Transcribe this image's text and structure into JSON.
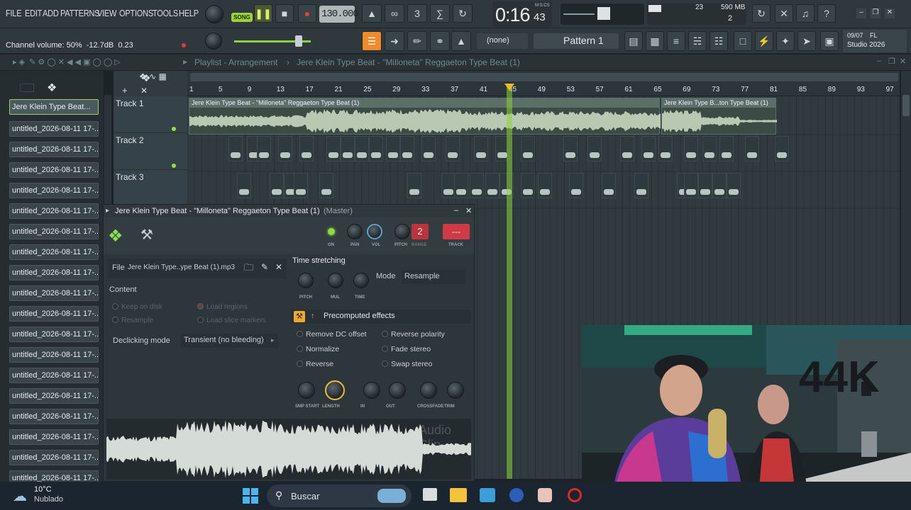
{
  "menu": [
    "FILE",
    "EDIT",
    "ADD",
    "PATTERNS",
    "VIEW",
    "OPTIONS",
    "TOOLS",
    "HELP"
  ],
  "transport": {
    "song_label": "SONG",
    "tempo": "130.000",
    "time": "0:16",
    "time_sub": "43",
    "time_unit": "M:S:CS"
  },
  "perf": {
    "cpu_value": "23",
    "memory": "590 MB",
    "poly": "2"
  },
  "hint": {
    "text": "Channel volume: 50%  -12.7dB  0.23"
  },
  "pattern": {
    "none_label": "(none)",
    "pattern_label": "Pattern 1"
  },
  "news": {
    "date": "09/07",
    "brand": "FL",
    "subtitle": "Studio 2026"
  },
  "playlist": {
    "title": "Playlist - Arrangement",
    "breadcrumb": "Jere Klein Type Beat - \"Milloneta\" Reggaeton Type Beat (1)"
  },
  "browser": {
    "items": [
      "Jere Klein Type Beat...",
      "untitled_2026-08-11 17-...",
      "untitled_2026-08-11 17-...",
      "untitled_2026-08-11 17-...",
      "untitled_2026-08-11 17-...",
      "untitled_2026-08-11 17-...",
      "untitled_2026-08-11 17-...",
      "untitled_2026-08-11 17-...",
      "untitled_2026-08-11 17-...",
      "untitled_2026-08-11 17-...",
      "untitled_2026-08-11 17-...",
      "untitled_2026-08-11 17-...",
      "untitled_2026-08-11 17-...",
      "untitled_2026-08-11 17-...",
      "untitled_2026-08-11 17-...",
      "untitled_2026-08-11 17-...",
      "untitled_2026-08-11 17-...",
      "untitled_2026-08-11 17-...",
      "untitled_2026-08-11 17-..."
    ]
  },
  "tracks": [
    "Track 1",
    "Track 2",
    "Track 3"
  ],
  "timeline": [
    "1",
    "5",
    "9",
    "13",
    "17",
    "21",
    "25",
    "29",
    "33",
    "37",
    "41",
    "45",
    "49",
    "53",
    "57",
    "61",
    "65",
    "69",
    "73",
    "77",
    "81",
    "85",
    "89",
    "93",
    "97"
  ],
  "clips": {
    "main": "Jere Klein Type Beat - \"Milloneta\" Reggaeton Type Beat (1)",
    "second": "Jere Klein Type B...ton Type Beat (1)"
  },
  "channel": {
    "title": "Jere Klein Type Beat - \"Milloneta\" Reggaeton Type Beat (1)",
    "title_suffix": "(Master)",
    "labels": {
      "on": "ON",
      "pan": "PAN",
      "vol": "VOL",
      "pitch": "PITCH",
      "range": "RANGE",
      "track": "TRACK"
    },
    "range_value": "2",
    "track_value": "---",
    "file_label": "File",
    "file_name": "Jere Klein Type..ype Beat (1).mp3",
    "content_label": "Content",
    "content_options": [
      "Keep on disk",
      "Load regions",
      "Resample",
      "Load slice markers"
    ],
    "declicking_label": "Declicking mode",
    "declicking_value": "Transient (no bleeding)",
    "time_stretching": "Time stretching",
    "ts_knobs": [
      "PITCH",
      "MUL",
      "TIME"
    ],
    "mode_label": "Mode",
    "mode_value": "Resample",
    "precomputed": "Precomputed effects",
    "effects": [
      "Remove DC offset",
      "Reverse polarity",
      "Normalize",
      "Fade stereo",
      "Reverse",
      "Swap stereo"
    ],
    "bottom_knobs": [
      "SMP START",
      "LENGTH",
      "IN",
      "OUT",
      "CROSSFADE",
      "TRIM"
    ],
    "watermark": "Audio Clip"
  },
  "taskbar": {
    "temperature": "10°C",
    "weather": "Nublado",
    "search_placeholder": "Buscar"
  },
  "webcam": {
    "wall_text": "44K"
  }
}
